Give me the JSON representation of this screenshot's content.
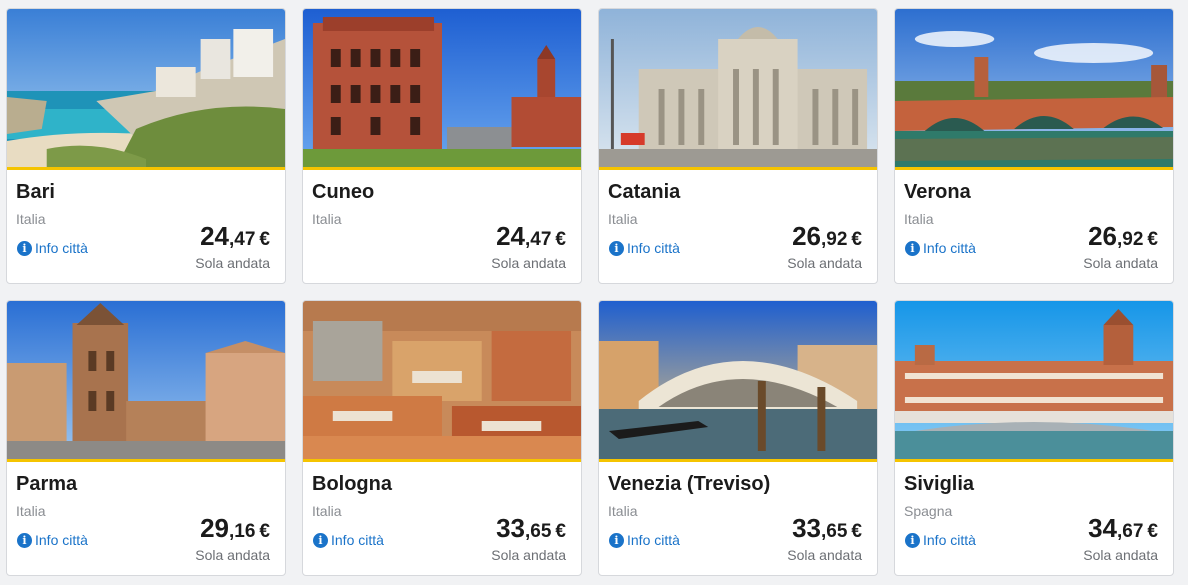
{
  "labels": {
    "info": "Info città",
    "oneway": "Sola andata",
    "info_icon": "info-icon"
  },
  "colors": {
    "accent": "#f5c400",
    "link": "#1a73c9"
  },
  "cards": [
    {
      "city": "Bari",
      "country": "Italia",
      "price_int": "24",
      "price_dec": ",47",
      "currency": "€",
      "show_info": true,
      "scene": "bari"
    },
    {
      "city": "Cuneo",
      "country": "Italia",
      "price_int": "24",
      "price_dec": ",47",
      "currency": "€",
      "show_info": false,
      "scene": "cuneo"
    },
    {
      "city": "Catania",
      "country": "Italia",
      "price_int": "26",
      "price_dec": ",92",
      "currency": "€",
      "show_info": true,
      "scene": "catania"
    },
    {
      "city": "Verona",
      "country": "Italia",
      "price_int": "26",
      "price_dec": ",92",
      "currency": "€",
      "show_info": true,
      "scene": "verona"
    },
    {
      "city": "Parma",
      "country": "Italia",
      "price_int": "29",
      "price_dec": ",16",
      "currency": "€",
      "show_info": true,
      "scene": "parma"
    },
    {
      "city": "Bologna",
      "country": "Italia",
      "price_int": "33",
      "price_dec": ",65",
      "currency": "€",
      "show_info": true,
      "scene": "bologna"
    },
    {
      "city": "Venezia (Treviso)",
      "country": "Italia",
      "price_int": "33",
      "price_dec": ",65",
      "currency": "€",
      "show_info": true,
      "scene": "venezia"
    },
    {
      "city": "Siviglia",
      "country": "Spagna",
      "price_int": "34",
      "price_dec": ",67",
      "currency": "€",
      "show_info": true,
      "scene": "siviglia"
    }
  ]
}
